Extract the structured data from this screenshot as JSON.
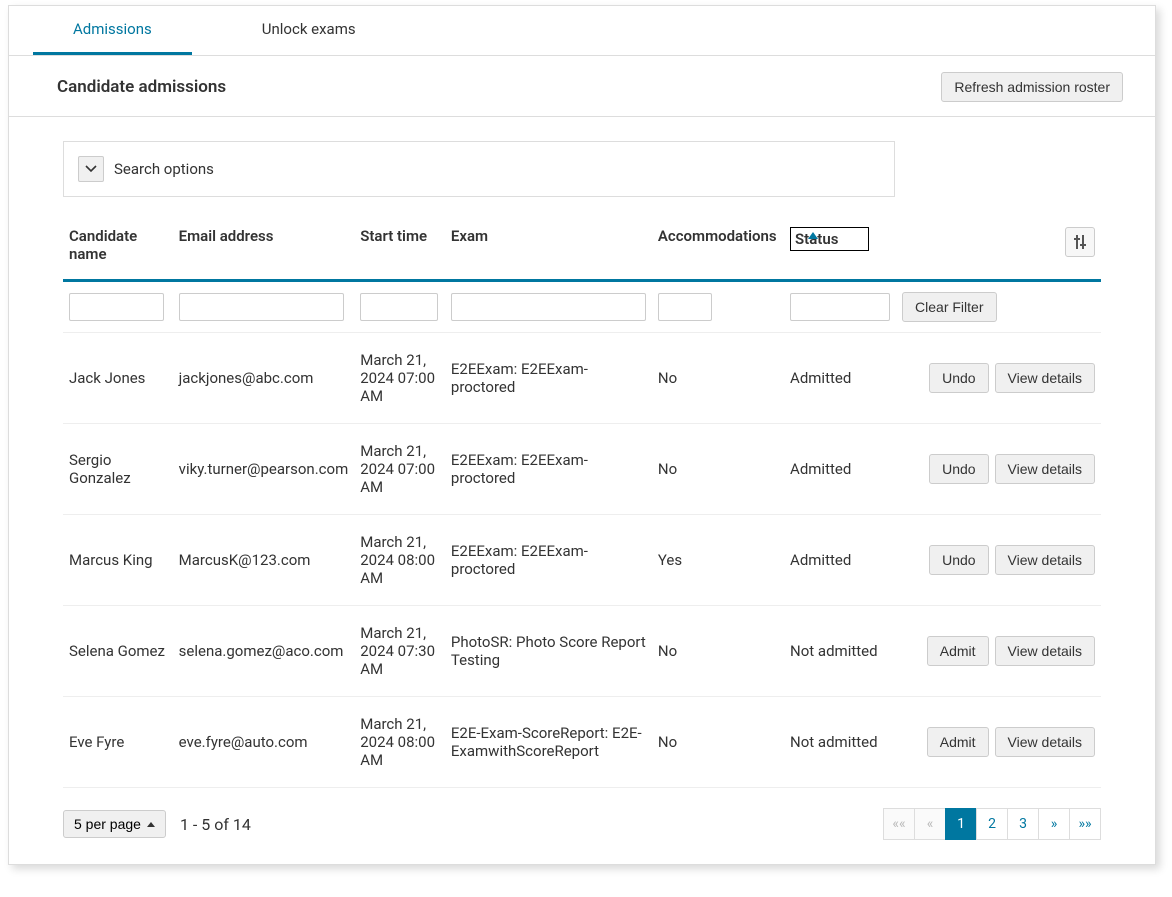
{
  "tabs": [
    {
      "label": "Admissions",
      "active": true
    },
    {
      "label": "Unlock exams",
      "active": false
    }
  ],
  "header": {
    "title": "Candidate admissions",
    "refresh_label": "Refresh admission roster"
  },
  "search": {
    "label": "Search options"
  },
  "columns": {
    "candidate_name": "Candidate name",
    "email": "Email address",
    "start_time": "Start time",
    "exam": "Exam",
    "accommodations": "Accommodations",
    "status": "Status"
  },
  "buttons": {
    "clear_filter": "Clear Filter",
    "undo": "Undo",
    "admit": "Admit",
    "view_details": "View details"
  },
  "rows": [
    {
      "name": "Jack Jones",
      "email": "jackjones@abc.com",
      "start": "March 21, 2024 07:00 AM",
      "exam": "E2EExam: E2EExam-proctored",
      "accom": "No",
      "status": "Admitted",
      "action": "undo"
    },
    {
      "name": "Sergio Gonzalez",
      "email": "viky.turner@pearson.com",
      "start": "March 21, 2024 07:00 AM",
      "exam": "E2EExam: E2EExam-proctored",
      "accom": "No",
      "status": "Admitted",
      "action": "undo"
    },
    {
      "name": "Marcus King",
      "email": "MarcusK@123.com",
      "start": "March 21, 2024 08:00 AM",
      "exam": "E2EExam: E2EExam-proctored",
      "accom": "Yes",
      "status": "Admitted",
      "action": "undo"
    },
    {
      "name": "Selena Gomez",
      "email": "selena.gomez@aco.com",
      "start": "March 21, 2024 07:30 AM",
      "exam": "PhotoSR: Photo Score Report Testing",
      "accom": "No",
      "status": "Not admitted",
      "action": "admit"
    },
    {
      "name": "Eve Fyre",
      "email": "eve.fyre@auto.com",
      "start": "March 21, 2024 08:00 AM",
      "exam": "E2E-Exam-ScoreReport: E2E-ExamwithScoreReport",
      "accom": "No",
      "status": "Not admitted",
      "action": "admit"
    }
  ],
  "footer": {
    "per_page_label": "5 per page",
    "range_text": "1 - 5 of 14",
    "pages": [
      "1",
      "2",
      "3"
    ],
    "active_page": "1",
    "nav": {
      "first": "««",
      "prev": "«",
      "next": "»",
      "last": "»»"
    }
  }
}
